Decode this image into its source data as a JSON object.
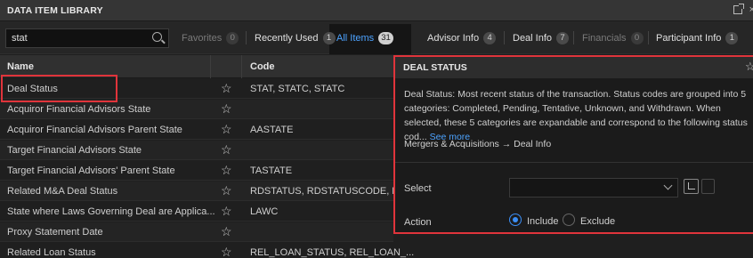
{
  "window": {
    "title": "DATA ITEM LIBRARY"
  },
  "search": {
    "value": "stat"
  },
  "tabs": [
    {
      "label": "Favorites",
      "count": "0"
    },
    {
      "label": "Recently Used",
      "count": "1"
    },
    {
      "label": "All Items",
      "count": "31"
    },
    {
      "label": "Advisor Info",
      "count": "4"
    },
    {
      "label": "Deal Info",
      "count": "7"
    },
    {
      "label": "Financials",
      "count": "0"
    },
    {
      "label": "Participant Info",
      "count": "1"
    }
  ],
  "table": {
    "headers": {
      "name": "Name",
      "code": "Code"
    },
    "rows": [
      {
        "name": "Deal Status",
        "code": "STAT, STATC, STATC"
      },
      {
        "name": "Acquiror Financial Advisors State",
        "code": ""
      },
      {
        "name": "Acquiror Financial Advisors Parent State",
        "code": "AASTATE"
      },
      {
        "name": "Target Financial Advisors State",
        "code": ""
      },
      {
        "name": "Target Financial Advisors' Parent State",
        "code": "TASTATE"
      },
      {
        "name": "Related M&A Deal Status",
        "code": "RDSTATUS, RDSTATUSCODE, R..."
      },
      {
        "name": "State where Laws Governing Deal are Applica...",
        "code": "LAWC"
      },
      {
        "name": "Proxy Statement Date",
        "code": ""
      },
      {
        "name": "Related Loan Status",
        "code": "REL_LOAN_STATUS, REL_LOAN_..."
      }
    ]
  },
  "detail": {
    "title": "DEAL STATUS",
    "description": "Deal Status: Most recent status of the transaction. Status codes are grouped into 5 categories: Completed, Pending, Tentative, Unknown, and Withdrawn. When selected, these 5 categories are expandable and correspond to the following status cod...",
    "see_more": "See more",
    "path": "Mergers & Acquisitions → Deal Info",
    "select_label": "Select",
    "action_label": "Action",
    "include_label": "Include",
    "exclude_label": "Exclude",
    "selected_action": "Include"
  },
  "colors": {
    "accent": "#4da3ff",
    "highlight": "#e0343b",
    "radio": "#3b8ef5"
  }
}
